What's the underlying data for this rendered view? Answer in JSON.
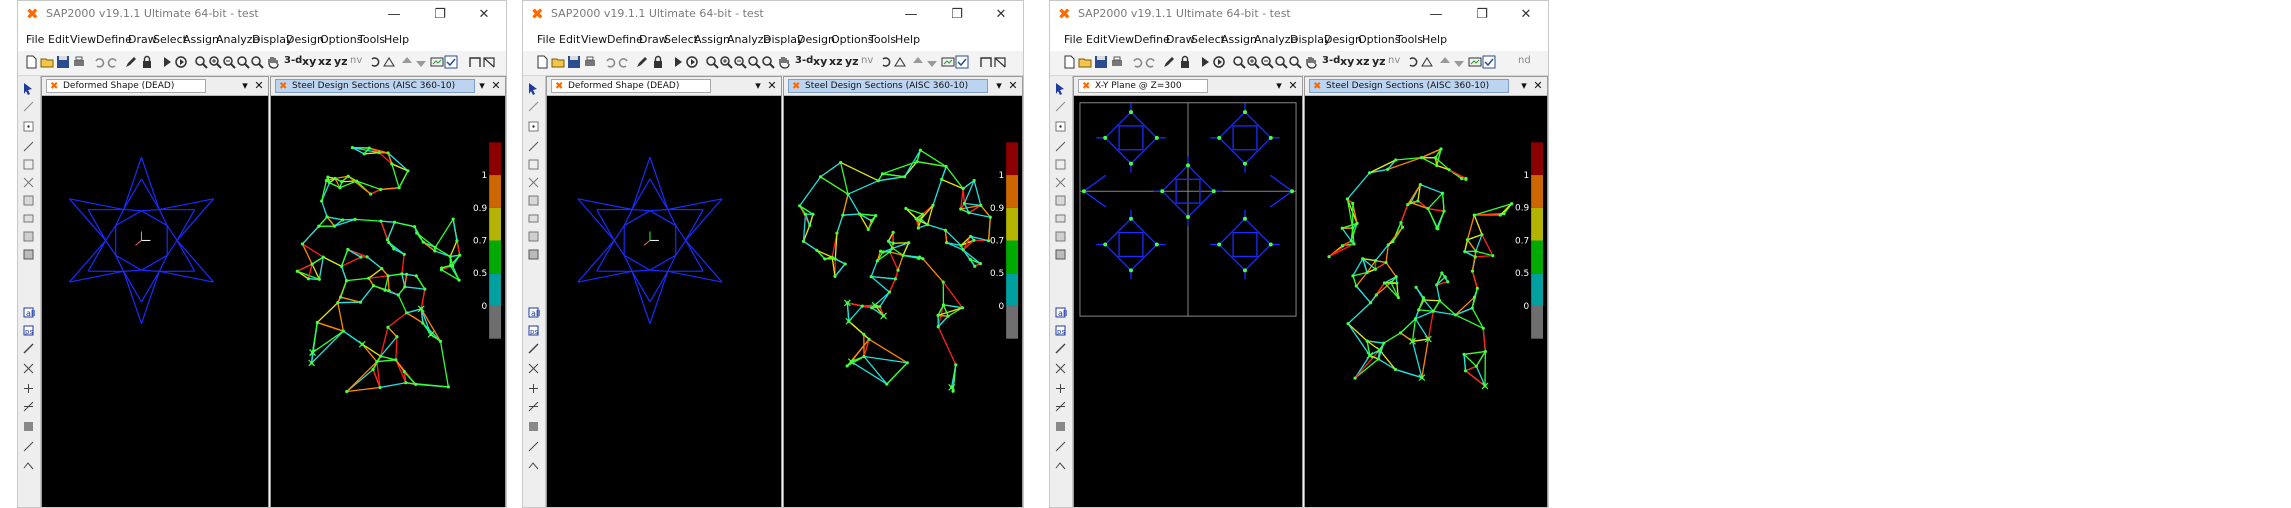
{
  "windows": [
    {
      "title": "SAP2000 v19.1.1 Ultimate 64-bit - test",
      "panes": [
        {
          "tab_label": "Deformed Shape (DEAD)",
          "kind": "deformed"
        },
        {
          "tab_label": "Steel Design Sections  (AISC 360-10)",
          "kind": "design",
          "seed": 11
        }
      ]
    },
    {
      "title": "SAP2000 v19.1.1 Ultimate 64-bit - test",
      "panes": [
        {
          "tab_label": "Deformed Shape (DEAD)",
          "kind": "deformed"
        },
        {
          "tab_label": "Steel Design Sections  (AISC 360-10)",
          "kind": "design",
          "seed": 23
        }
      ]
    },
    {
      "title": "SAP2000 v19.1.1 Ultimate 64-bit - test",
      "panes": [
        {
          "tab_label": "X-Y Plane @ Z=300",
          "kind": "plan"
        },
        {
          "tab_label": "Steel Design Sections  (AISC 360-10)",
          "kind": "design",
          "seed": 37
        }
      ]
    }
  ],
  "menu": [
    "File",
    "Edit",
    "View",
    "Define",
    "Draw",
    "Select",
    "Assign",
    "Analyze",
    "Display",
    "Design",
    "Options",
    "Tools",
    "Help"
  ],
  "toolbar_text": {
    "view_3d": "3-d",
    "view_xy": "xy",
    "view_xz": "xz",
    "view_yz": "yz",
    "view_nv": "nv",
    "view_nd": "nd"
  },
  "window_controls": {
    "minimize": "—",
    "maximize": "❐",
    "close": "✕"
  },
  "pane_controls": {
    "dropdown": "▾",
    "close": "✕"
  },
  "legend": {
    "labels": [
      "1",
      "0.9",
      "0.7",
      "0.5",
      "0"
    ],
    "colors": [
      "#8b0000",
      "#cc6600",
      "#b3b300",
      "#00aa00",
      "#00a0a0",
      "#6e6e6e"
    ]
  },
  "colors": {
    "structure": "#1a2cff",
    "member_cyan": "#20e0e0",
    "member_green": "#33ff33",
    "member_yellow": "#e8e800",
    "member_red": "#ff2020",
    "member_orange": "#ff8800",
    "support": "#44ff44"
  }
}
